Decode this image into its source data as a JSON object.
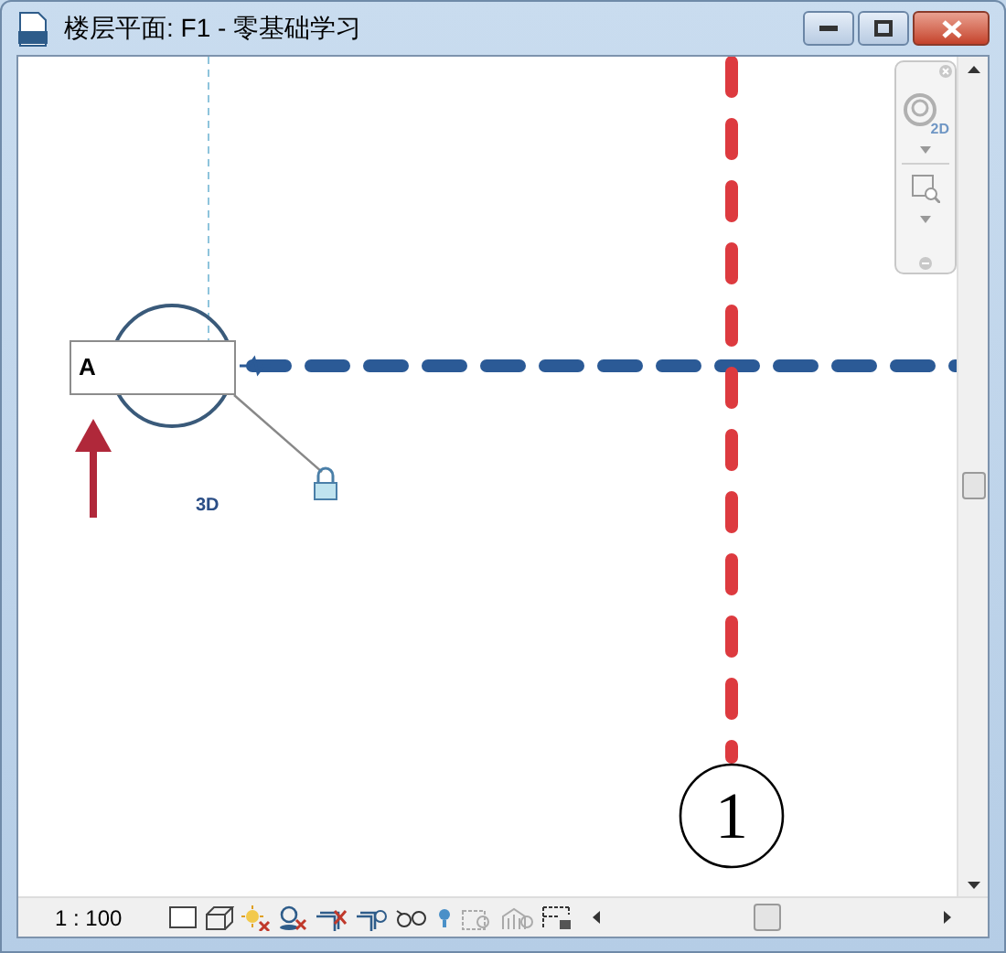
{
  "window": {
    "title": "楼层平面: F1 - 零基础学习"
  },
  "canvas": {
    "grid_bubble": "1",
    "text_field": {
      "value": "A"
    },
    "view_label": "3D"
  },
  "navigation_bar": {
    "wheel_label": "2D"
  },
  "view_control_bar": {
    "scale": "1 : 100"
  }
}
